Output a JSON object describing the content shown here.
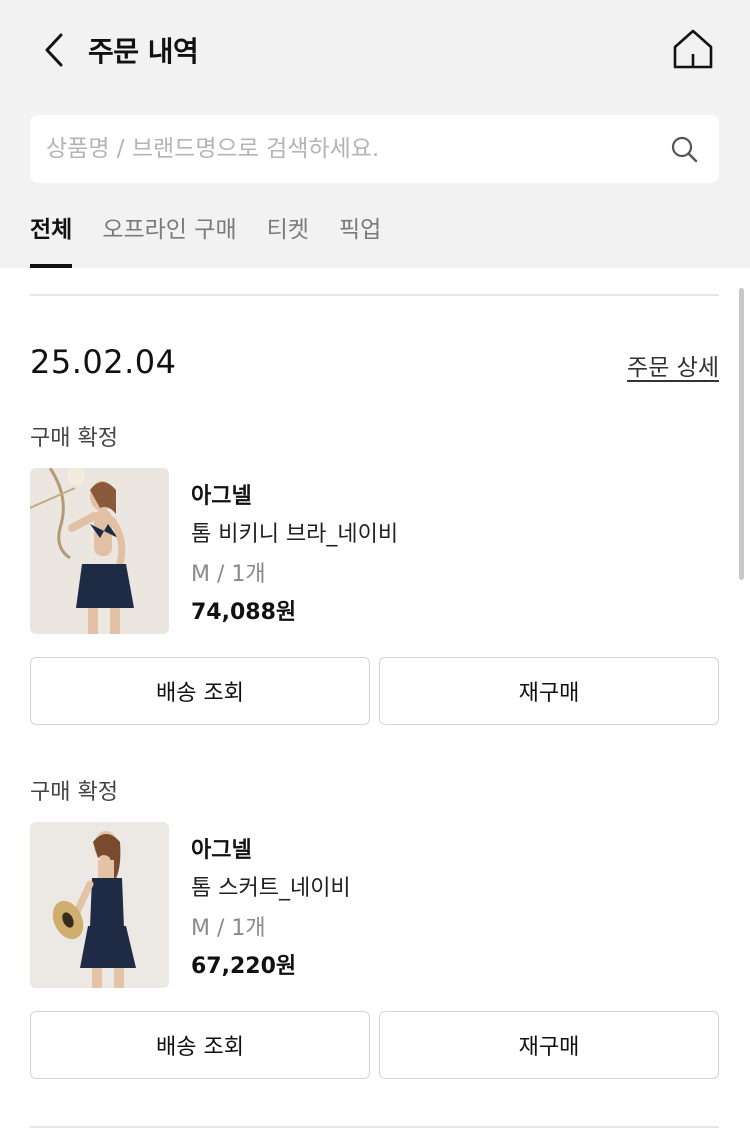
{
  "header": {
    "title": "주문 내역",
    "back_icon": "chevron-left-icon",
    "home_icon": "home-icon"
  },
  "search": {
    "placeholder": "상품명 / 브랜드명으로 검색하세요.",
    "value": "",
    "icon": "search-icon"
  },
  "tabs": [
    {
      "label": "전체",
      "active": true
    },
    {
      "label": "오프라인 구매",
      "active": false
    },
    {
      "label": "티켓",
      "active": false
    },
    {
      "label": "픽업",
      "active": false
    }
  ],
  "order": {
    "date": "25.02.04",
    "detail_link": "주문 상세",
    "items": [
      {
        "status": "구매 확정",
        "brand": "아그넬",
        "name": "톰 비키니 브라_네이비",
        "option": "M / 1개",
        "price": "74,088원",
        "buttons": [
          "배송 조회",
          "재구매"
        ]
      },
      {
        "status": "구매 확정",
        "brand": "아그넬",
        "name": "톰 스커트_네이비",
        "option": "M / 1개",
        "price": "67,220원",
        "buttons": [
          "배송 조회",
          "재구매"
        ]
      }
    ]
  },
  "colors": {
    "header_bg": "#f2f2f2",
    "text": "#111111",
    "muted": "#8a8a8a",
    "border": "#d4d4d4"
  }
}
